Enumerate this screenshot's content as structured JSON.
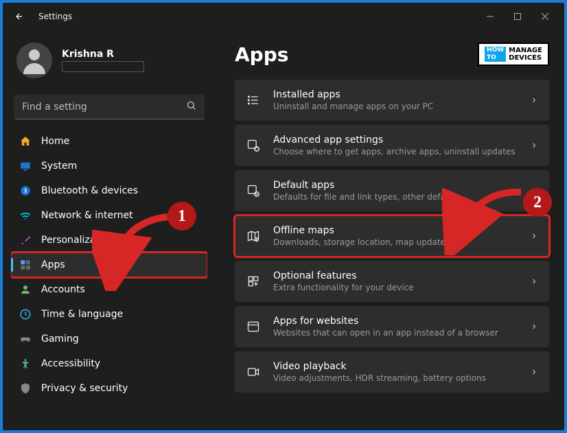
{
  "window": {
    "title": "Settings"
  },
  "profile": {
    "name": "Krishna R",
    "email": ""
  },
  "search": {
    "placeholder": "Find a setting"
  },
  "nav": {
    "items": [
      {
        "id": "home",
        "label": "Home"
      },
      {
        "id": "system",
        "label": "System"
      },
      {
        "id": "bluetooth",
        "label": "Bluetooth & devices"
      },
      {
        "id": "network",
        "label": "Network & internet"
      },
      {
        "id": "personalization",
        "label": "Personalization"
      },
      {
        "id": "apps",
        "label": "Apps",
        "selected": true
      },
      {
        "id": "accounts",
        "label": "Accounts"
      },
      {
        "id": "time",
        "label": "Time & language"
      },
      {
        "id": "gaming",
        "label": "Gaming"
      },
      {
        "id": "accessibility",
        "label": "Accessibility"
      },
      {
        "id": "privacy",
        "label": "Privacy & security"
      }
    ]
  },
  "main": {
    "title": "Apps",
    "brand": {
      "left1": "HOW",
      "left2": "TO",
      "right1": "MANAGE",
      "right2": "DEVICES"
    },
    "cards": [
      {
        "id": "installed",
        "title": "Installed apps",
        "desc": "Uninstall and manage apps on your PC"
      },
      {
        "id": "advanced",
        "title": "Advanced app settings",
        "desc": "Choose where to get apps, archive apps, uninstall updates"
      },
      {
        "id": "default",
        "title": "Default apps",
        "desc": "Defaults for file and link types, other defaults"
      },
      {
        "id": "offline-maps",
        "title": "Offline maps",
        "desc": "Downloads, storage location, map updates",
        "highlight": true
      },
      {
        "id": "optional",
        "title": "Optional features",
        "desc": "Extra functionality for your device"
      },
      {
        "id": "websites",
        "title": "Apps for websites",
        "desc": "Websites that can open in an app instead of a browser"
      },
      {
        "id": "video",
        "title": "Video playback",
        "desc": "Video adjustments, HDR streaming, battery options"
      }
    ]
  },
  "annotations": {
    "badge1": "1",
    "badge2": "2"
  }
}
